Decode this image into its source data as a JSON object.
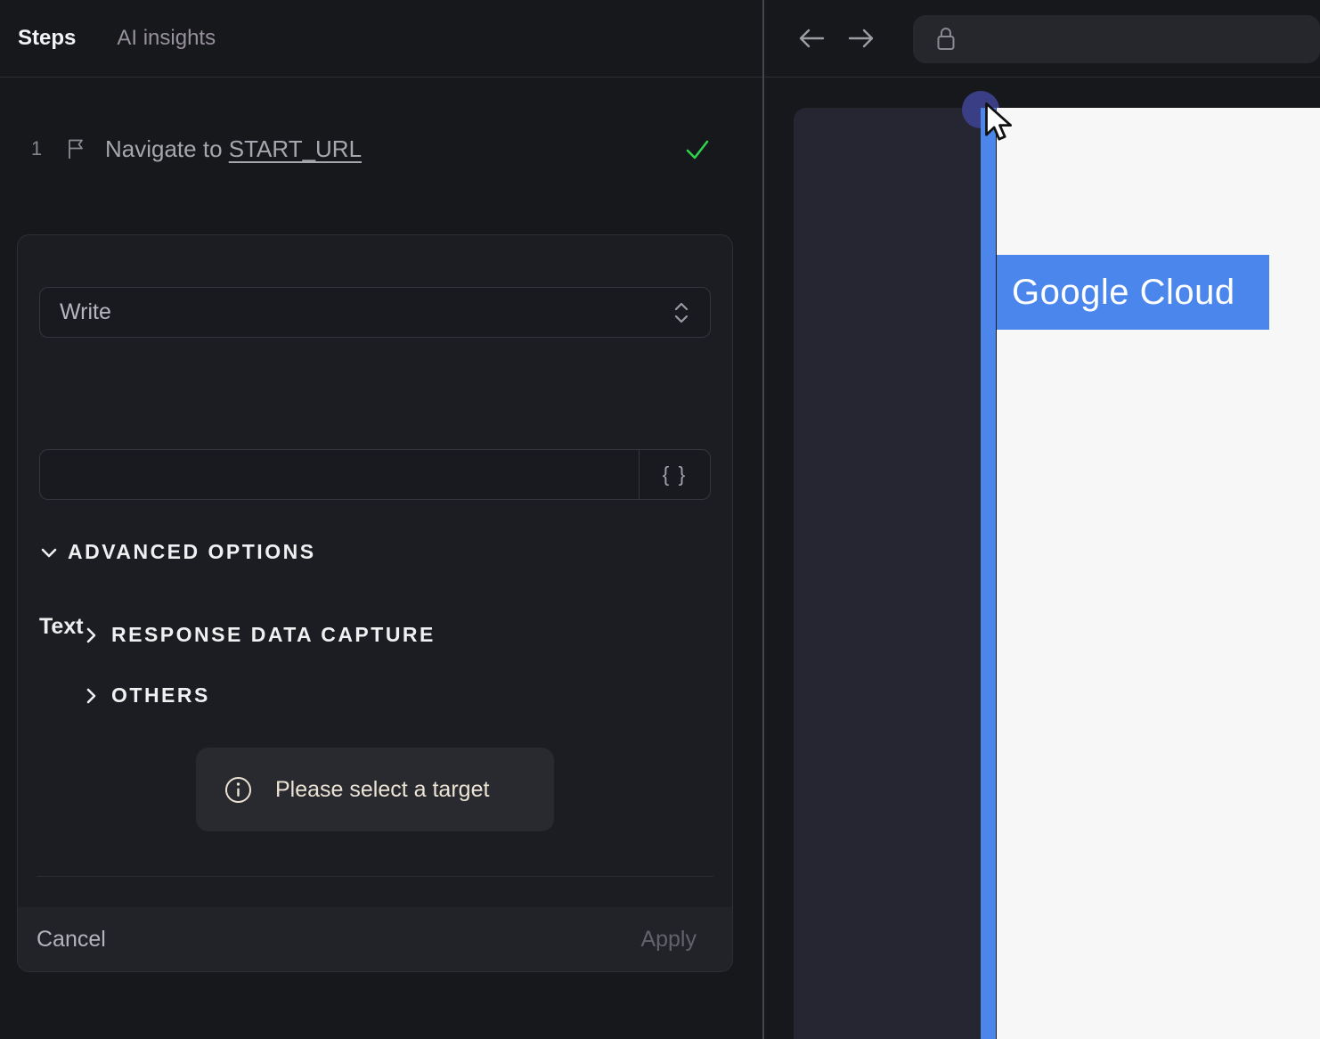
{
  "colors": {
    "background": "#17181c",
    "card_bg": "#1c1d22",
    "accent_blue": "#4a86ec",
    "success_green": "#2fd24c",
    "notice_text": "#ebe3d4"
  },
  "left_panel": {
    "tabs": [
      {
        "label": "Steps",
        "active": true
      },
      {
        "label": "AI insights",
        "active": false
      }
    ],
    "step": {
      "index": "1",
      "flag_icon": "flag-icon",
      "text_prefix": "Navigate to ",
      "text_link": "START_URL",
      "status_icon": "check-icon"
    },
    "editor": {
      "action_select": {
        "value": "Write"
      },
      "text_field": {
        "label": "Text",
        "value": "",
        "placeholder": ""
      },
      "braces_button_label": "{ }",
      "advanced_options_label": "ADVANCED OPTIONS",
      "sections": [
        {
          "label": "RESPONSE DATA CAPTURE"
        },
        {
          "label": "OTHERS"
        }
      ],
      "notice": "Please select a target",
      "cancel_label": "Cancel",
      "apply_label": "Apply"
    }
  },
  "browser": {
    "nav": {
      "back_icon": "arrow-left",
      "forward_icon": "arrow-right",
      "lock_icon": "lock",
      "url_value": ""
    },
    "page": {
      "highlight_label": "Google Cloud"
    }
  }
}
